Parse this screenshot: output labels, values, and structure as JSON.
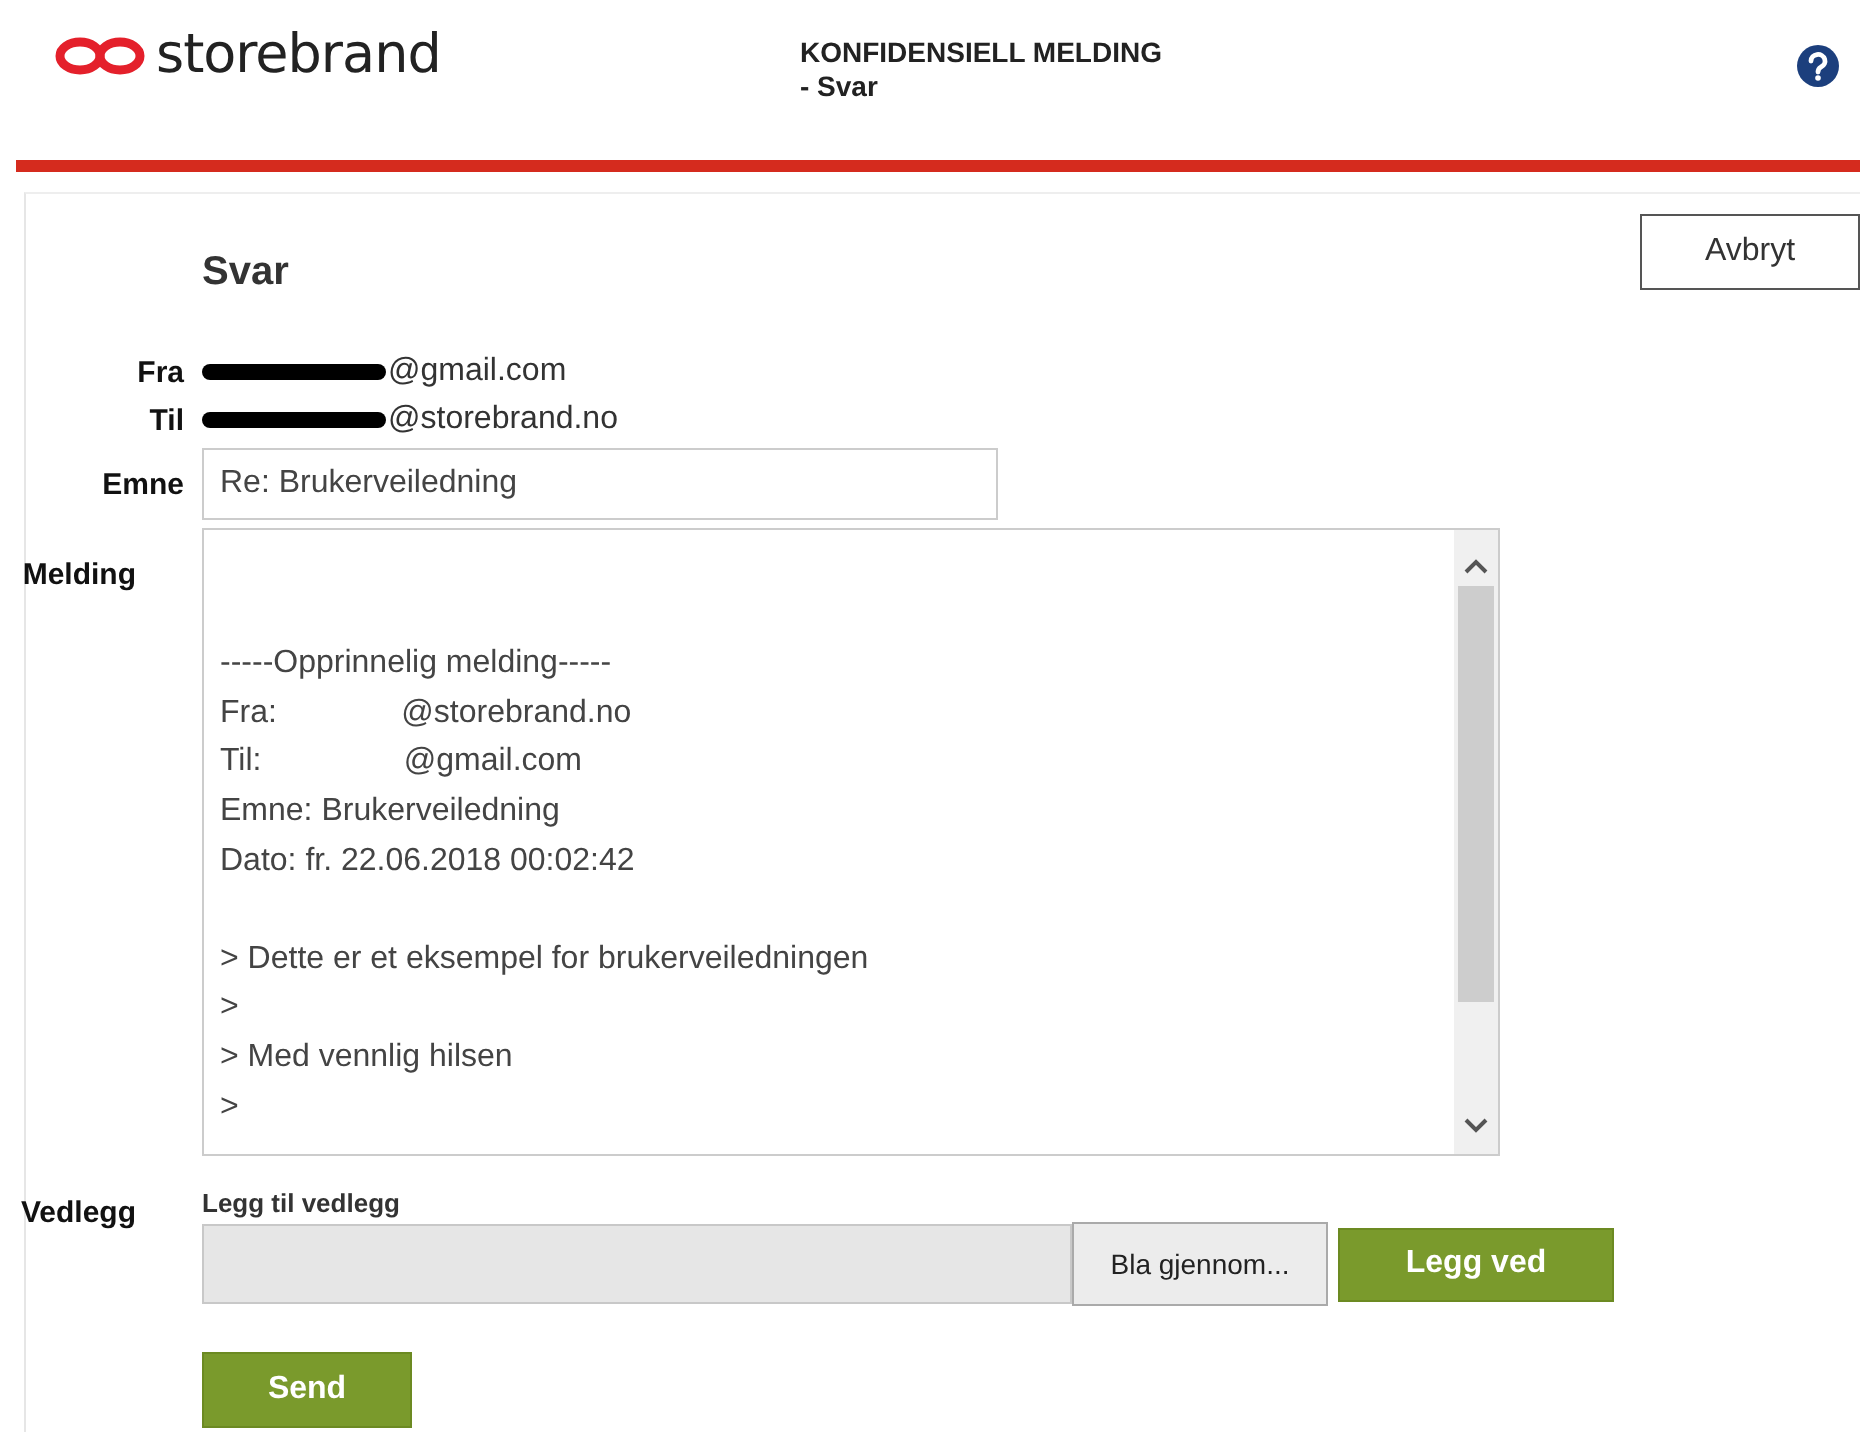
{
  "header": {
    "brand": "storebrand",
    "title": "KONFIDENSIELL MELDING",
    "subtitle": "- Svar"
  },
  "form": {
    "heading": "Svar",
    "cancel": "Avbryt",
    "from": {
      "label": "Fra",
      "redacted": true,
      "value": "@gmail.com"
    },
    "to": {
      "label": "Til",
      "redacted": true,
      "value": "@storebrand.no"
    },
    "subject": {
      "label": "Emne",
      "value": "Re: Brukerveiledning"
    },
    "message": {
      "label": "Melding",
      "text": "\n\n-----Opprinnelig melding-----\nFra:              @storebrand.no\nTil:                @gmail.com\nEmne: Brukerveiledning\nDato: fr. 22.06.2018 00:02:42\n\n> Dette er et eksempel for brukerveiledningen\n>\n> Med vennlig hilsen\n>"
    },
    "attachment": {
      "label": "Vedlegg",
      "caption": "Legg til vedlegg",
      "browse": "Bla gjennom...",
      "add": "Legg ved"
    },
    "send": "Send"
  }
}
